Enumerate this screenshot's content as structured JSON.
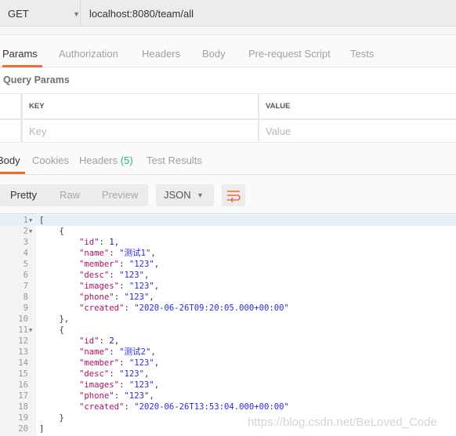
{
  "request": {
    "method": "GET",
    "url": "localhost:8080/team/all"
  },
  "request_tabs": [
    "Params",
    "Authorization",
    "Headers",
    "Body",
    "Pre-request Script",
    "Tests"
  ],
  "query_params": {
    "title": "Query Params",
    "columns": [
      "KEY",
      "VALUE"
    ],
    "placeholders": {
      "key": "Key",
      "value": "Value"
    }
  },
  "response_tabs": {
    "body": "Body",
    "cookies": "Cookies",
    "headers": "Headers",
    "headers_count": "(5)",
    "tests": "Test Results"
  },
  "toolbar": {
    "modes": [
      "Pretty",
      "Raw",
      "Preview"
    ],
    "format": "JSON",
    "wrap_icon": "wrap-lines-icon"
  },
  "colors": {
    "accent": "#f26b3a",
    "count": "#26b47f",
    "key": "#a31567",
    "string": "#2b2bdb"
  },
  "code": [
    [
      [
        "p",
        "["
      ]
    ],
    [
      [
        "p",
        "    {"
      ]
    ],
    [
      [
        "p",
        "        "
      ],
      [
        "k",
        "\"id\""
      ],
      [
        "p",
        ": "
      ],
      [
        "n",
        "1"
      ],
      [
        "p",
        ","
      ]
    ],
    [
      [
        "p",
        "        "
      ],
      [
        "k",
        "\"name\""
      ],
      [
        "p",
        ": "
      ],
      [
        "s",
        "\"测试1\""
      ],
      [
        "p",
        ","
      ]
    ],
    [
      [
        "p",
        "        "
      ],
      [
        "k",
        "\"member\""
      ],
      [
        "p",
        ": "
      ],
      [
        "s",
        "\"123\""
      ],
      [
        "p",
        ","
      ]
    ],
    [
      [
        "p",
        "        "
      ],
      [
        "k",
        "\"desc\""
      ],
      [
        "p",
        ": "
      ],
      [
        "s",
        "\"123\""
      ],
      [
        "p",
        ","
      ]
    ],
    [
      [
        "p",
        "        "
      ],
      [
        "k",
        "\"images\""
      ],
      [
        "p",
        ": "
      ],
      [
        "s",
        "\"123\""
      ],
      [
        "p",
        ","
      ]
    ],
    [
      [
        "p",
        "        "
      ],
      [
        "k",
        "\"phone\""
      ],
      [
        "p",
        ": "
      ],
      [
        "s",
        "\"123\""
      ],
      [
        "p",
        ","
      ]
    ],
    [
      [
        "p",
        "        "
      ],
      [
        "k",
        "\"created\""
      ],
      [
        "p",
        ": "
      ],
      [
        "s",
        "\"2020-06-26T09:20:05.000+00:00\""
      ]
    ],
    [
      [
        "p",
        "    },"
      ]
    ],
    [
      [
        "p",
        "    {"
      ]
    ],
    [
      [
        "p",
        "        "
      ],
      [
        "k",
        "\"id\""
      ],
      [
        "p",
        ": "
      ],
      [
        "n",
        "2"
      ],
      [
        "p",
        ","
      ]
    ],
    [
      [
        "p",
        "        "
      ],
      [
        "k",
        "\"name\""
      ],
      [
        "p",
        ": "
      ],
      [
        "s",
        "\"测试2\""
      ],
      [
        "p",
        ","
      ]
    ],
    [
      [
        "p",
        "        "
      ],
      [
        "k",
        "\"member\""
      ],
      [
        "p",
        ": "
      ],
      [
        "s",
        "\"123\""
      ],
      [
        "p",
        ","
      ]
    ],
    [
      [
        "p",
        "        "
      ],
      [
        "k",
        "\"desc\""
      ],
      [
        "p",
        ": "
      ],
      [
        "s",
        "\"123\""
      ],
      [
        "p",
        ","
      ]
    ],
    [
      [
        "p",
        "        "
      ],
      [
        "k",
        "\"images\""
      ],
      [
        "p",
        ": "
      ],
      [
        "s",
        "\"123\""
      ],
      [
        "p",
        ","
      ]
    ],
    [
      [
        "p",
        "        "
      ],
      [
        "k",
        "\"phone\""
      ],
      [
        "p",
        ": "
      ],
      [
        "s",
        "\"123\""
      ],
      [
        "p",
        ","
      ]
    ],
    [
      [
        "p",
        "        "
      ],
      [
        "k",
        "\"created\""
      ],
      [
        "p",
        ": "
      ],
      [
        "s",
        "\"2020-06-26T13:53:04.000+00:00\""
      ]
    ],
    [
      [
        "p",
        "    }"
      ]
    ],
    [
      [
        "p",
        "]"
      ]
    ]
  ],
  "foldable_lines": [
    1,
    2,
    11
  ],
  "watermark": "https://blog.csdn.net/BeLoved_Code"
}
